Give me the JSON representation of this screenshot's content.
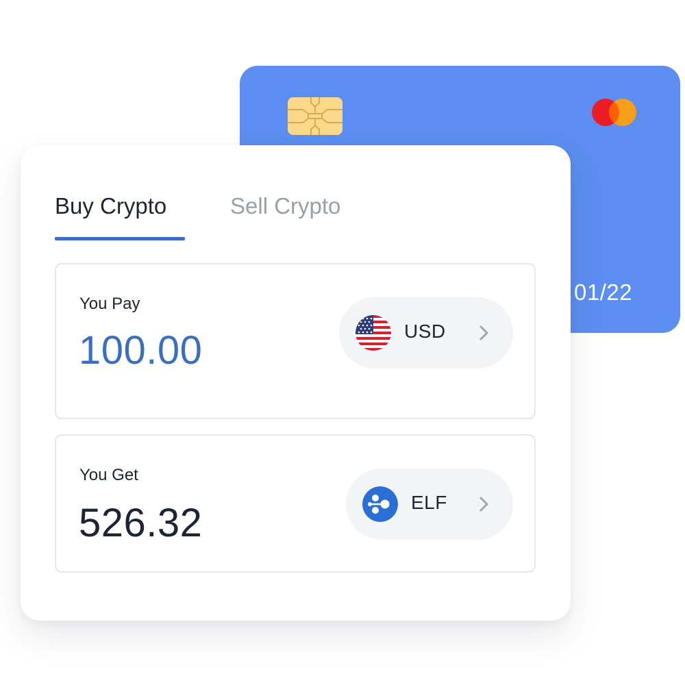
{
  "card": {
    "expiry": "01/22",
    "brand_icon": "mastercard-icon",
    "color": "#5b8ef0"
  },
  "tabs": [
    {
      "label": "Buy Crypto",
      "active": true
    },
    {
      "label": "Sell Crypto",
      "active": false
    }
  ],
  "pay": {
    "label": "You Pay",
    "amount": "100.00",
    "currency": "USD",
    "currency_icon": "us-flag-icon",
    "amount_color": "#3a6ec2"
  },
  "get": {
    "label": "You Get",
    "amount": "526.32",
    "currency": "ELF",
    "currency_icon": "elf-token-icon",
    "amount_color": "#1d2433"
  },
  "colors": {
    "accent": "#3a6ec2",
    "text": "#1d2433",
    "muted": "#9aa0a8"
  }
}
